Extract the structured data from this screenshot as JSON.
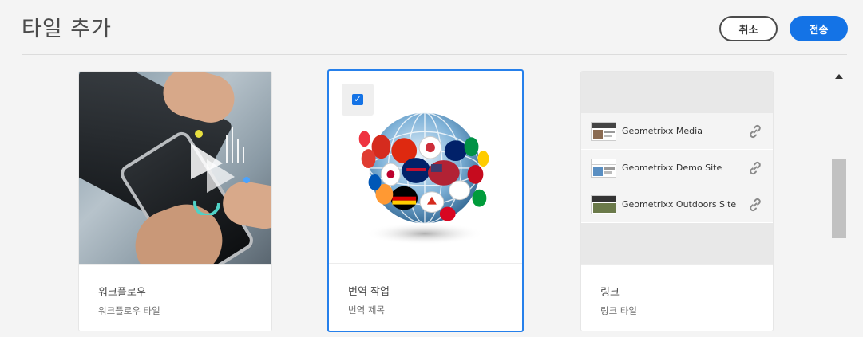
{
  "header": {
    "title": "타일 추가",
    "cancel_label": "취소",
    "submit_label": "전송"
  },
  "cards": [
    {
      "title": "워크플로우",
      "subtitle": "워크플로우 타일",
      "selected": false
    },
    {
      "title": "번역 작업",
      "subtitle": "번역 제목",
      "selected": true
    },
    {
      "title": "링크",
      "subtitle": "링크 타일",
      "selected": false
    }
  ],
  "links": [
    {
      "label": "Geometrixx Media",
      "icon": "link-icon"
    },
    {
      "label": "Geometrixx Demo Site",
      "icon": "link-icon"
    },
    {
      "label": "Geometrixx Outdoors Site",
      "icon": "link-icon"
    }
  ],
  "colors": {
    "accent": "#1473e6",
    "selected_border": "#2680eb"
  }
}
